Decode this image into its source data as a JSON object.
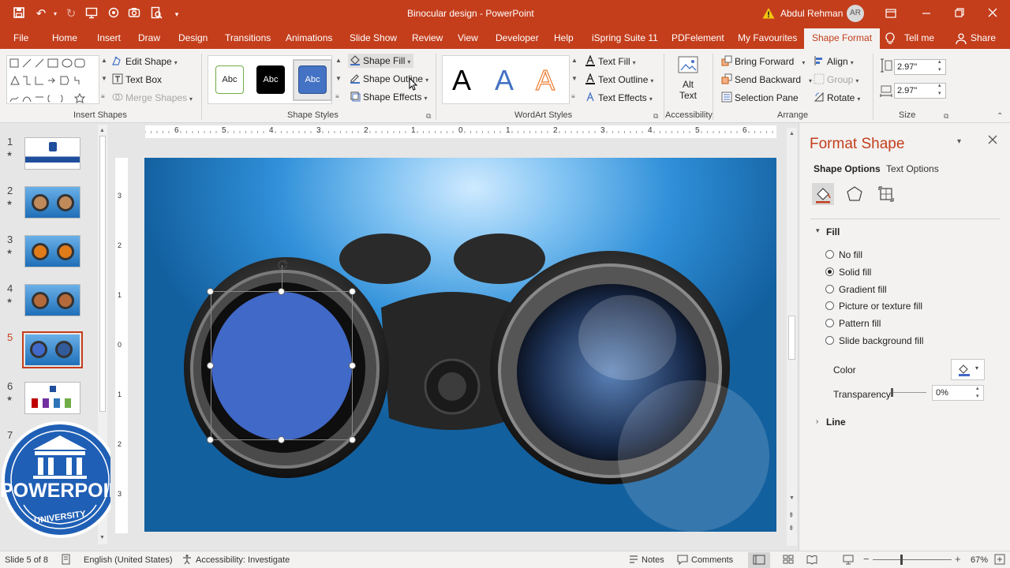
{
  "window": {
    "title": "Binocular design - PowerPoint",
    "user_name": "Abdul Rehman",
    "user_initials": "AR",
    "warning_icon": "warning-icon"
  },
  "tabs": [
    {
      "label": "File"
    },
    {
      "label": "Home"
    },
    {
      "label": "Insert"
    },
    {
      "label": "Draw"
    },
    {
      "label": "Design"
    },
    {
      "label": "Transitions"
    },
    {
      "label": "Animations"
    },
    {
      "label": "Slide Show"
    },
    {
      "label": "Review"
    },
    {
      "label": "View"
    },
    {
      "label": "Developer"
    },
    {
      "label": "Help"
    },
    {
      "label": "iSpring Suite 11"
    },
    {
      "label": "PDFelement"
    },
    {
      "label": "My Favourites"
    },
    {
      "label": "Shape Format",
      "active": true
    }
  ],
  "tell_me": "Tell me",
  "share": "Share",
  "ribbon": {
    "insert_shapes": {
      "label": "Insert Shapes",
      "edit_shape": "Edit Shape",
      "text_box": "Text Box",
      "merge_shapes": "Merge Shapes"
    },
    "shape_styles": {
      "label": "Shape Styles",
      "preset_text": "Abc",
      "shape_fill": "Shape Fill",
      "shape_outline": "Shape Outline",
      "shape_effects": "Shape Effects"
    },
    "wordart": {
      "label": "WordArt Styles",
      "letter": "A",
      "text_fill": "Text Fill",
      "text_outline": "Text Outline",
      "text_effects": "Text Effects"
    },
    "accessibility": {
      "label": "Accessibility",
      "alt_text_line1": "Alt",
      "alt_text_line2": "Text"
    },
    "arrange": {
      "label": "Arrange",
      "bring_forward": "Bring Forward",
      "send_backward": "Send Backward",
      "selection_pane": "Selection Pane",
      "align": "Align",
      "group": "Group",
      "rotate": "Rotate"
    },
    "size": {
      "label": "Size",
      "height": "2.97\"",
      "width": "2.97\""
    }
  },
  "ruler": {
    "labels": [
      "6",
      "5",
      "4",
      "3",
      "2",
      "1",
      "0",
      "1",
      "2",
      "3",
      "4",
      "5",
      "6"
    ],
    "vlabels": [
      "3",
      "2",
      "1",
      "0",
      "1",
      "2",
      "3"
    ]
  },
  "slides": [
    {
      "number": "1",
      "star": "★"
    },
    {
      "number": "2",
      "star": "★"
    },
    {
      "number": "3",
      "star": "★"
    },
    {
      "number": "4",
      "star": "★"
    },
    {
      "number": "5",
      "selected": true
    },
    {
      "number": "6",
      "star": "★"
    },
    {
      "number": "7"
    }
  ],
  "watermark": {
    "brand": "POWERPOINT",
    "sub": "UNIVERSITY"
  },
  "format_pane": {
    "title": "Format Shape",
    "tab_shape_options": "Shape Options",
    "tab_text_options": "Text Options",
    "fill_section": "Fill",
    "fill_options": [
      {
        "label": "No fill",
        "selected": false
      },
      {
        "label": "Solid fill",
        "selected": true
      },
      {
        "label": "Gradient fill",
        "selected": false
      },
      {
        "label": "Picture or texture fill",
        "selected": false
      },
      {
        "label": "Pattern fill",
        "selected": false
      },
      {
        "label": "Slide background fill",
        "selected": false
      }
    ],
    "color_label": "Color",
    "transparency_label": "Transparency",
    "transparency_value": "0%",
    "line_section": "Line",
    "fill_color": "#4169c8"
  },
  "status": {
    "slide_info": "Slide 5 of 8",
    "language": "English (United States)",
    "accessibility": "Accessibility: Investigate",
    "notes": "Notes",
    "comments": "Comments",
    "zoom": "67%"
  },
  "colors": {
    "accent": "#c43e1c",
    "shape_fill": "#4169c8",
    "slide_bg": "#1e7fc6"
  }
}
